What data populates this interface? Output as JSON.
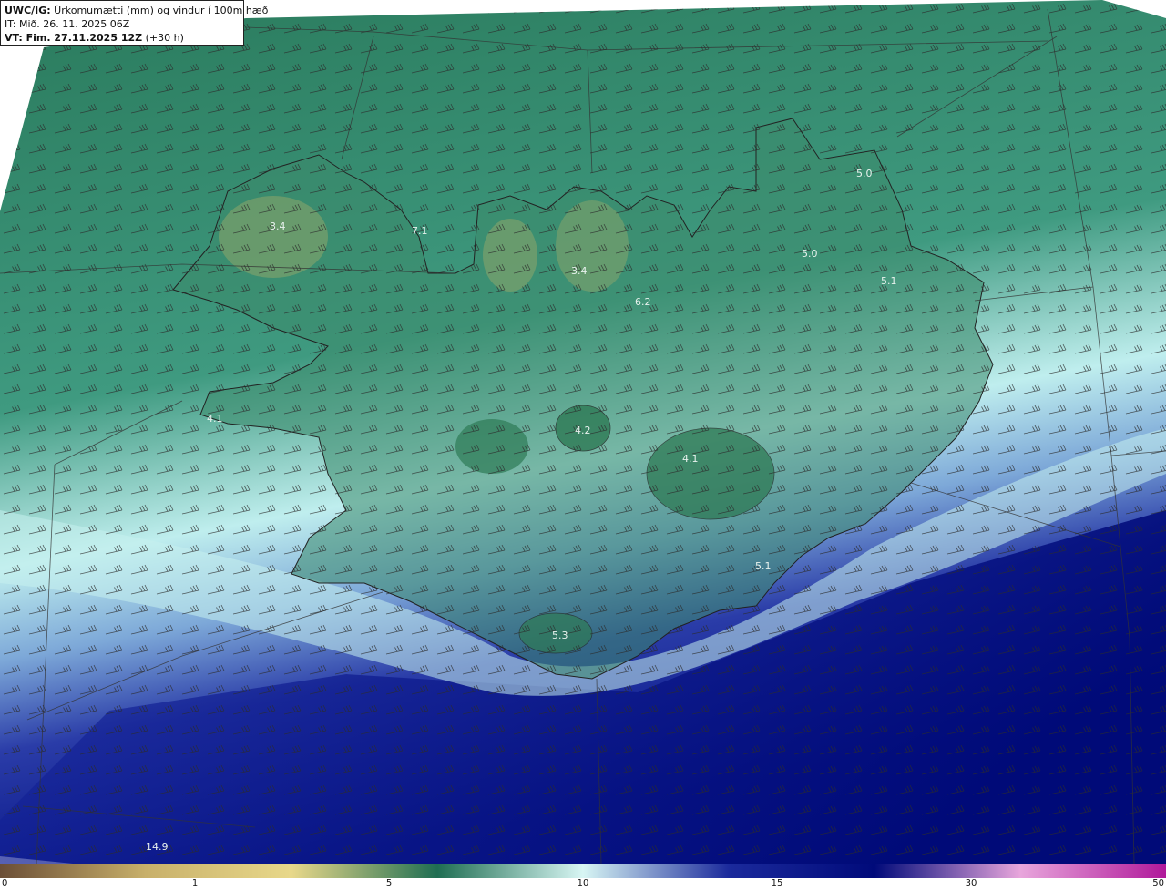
{
  "header": {
    "title_bold": "UWC/IG:",
    "title_rest": " Úrkomumætti (mm) og vindur í 100m hæð",
    "it_label": "IT:",
    "it_value": " Mið. 26. 11. 2025 06Z",
    "vt_bold": "VT: Fim. 27.11.2025 12Z",
    "vt_rest": " (+30 h)"
  },
  "map_labels": [
    "3.4",
    "7.1",
    "4.1",
    "3.4",
    "6.2",
    "5.0",
    "5.0",
    "5.1",
    "4.2",
    "4.1",
    "5.1",
    "5.3",
    "14.9"
  ],
  "colorbar": {
    "ticks": [
      "0",
      "1",
      "5",
      "10",
      "15",
      "30",
      "50"
    ],
    "colors": [
      "#6b4e36",
      "#c8b06a",
      "#e8d88a",
      "#1f6e52",
      "#d8f6f4",
      "#1b2a9c",
      "#000a7a",
      "#e8a6dc",
      "#b0189a"
    ]
  },
  "icons": {
    "wind_barb": "wind-barb-icon"
  }
}
